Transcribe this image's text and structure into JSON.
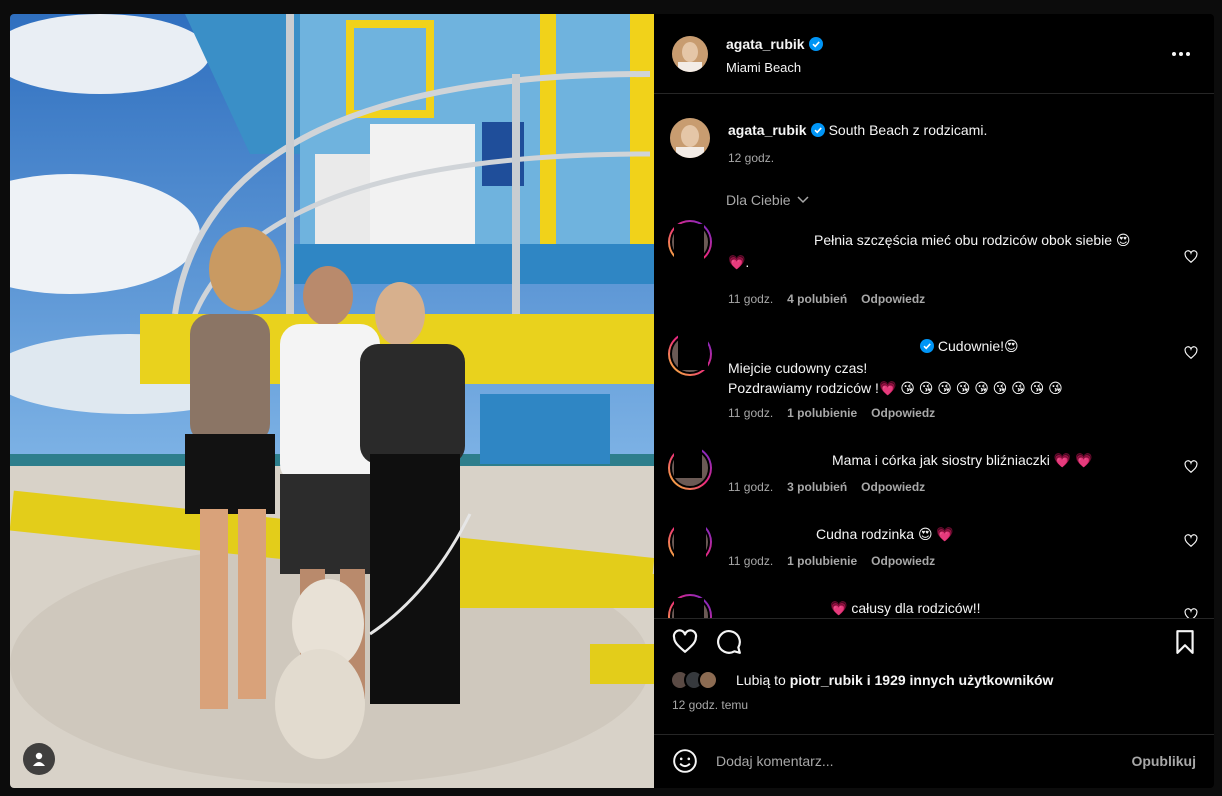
{
  "post": {
    "username": "agata_rubik",
    "location": "Miami Beach",
    "caption": "South Beach z rodzicami.",
    "caption_time": "12 godz.",
    "filter_label": "Dla Ciebie",
    "likes_prefix": "Lubią to ",
    "likes_user": "piotr_rubik",
    "likes_suffix": " i 1929 innych użytkowników",
    "posted": "12 godz. temu",
    "add_placeholder": "Dodaj komentarz...",
    "publish_label": "Opublikuj"
  },
  "comments": [
    {
      "text": "Pełnia szczęścia mieć obu rodziców obok siebie 😍",
      "text2": "💗.",
      "time": "11 godz.",
      "likes": "4 polubień",
      "reply": "Odpowiedz"
    },
    {
      "text": "Cudownie!😍",
      "text2": "Miejcie cudowny czas!",
      "text3": "Pozdrawiamy rodziców !💗 😘 😘 😘 😘 😘 😘 😘 😘 😘",
      "time": "11 godz.",
      "likes": "1 polubienie",
      "reply": "Odpowiedz"
    },
    {
      "text": "Mama i córka jak siostry bliźniaczki 💗 💗",
      "time": "11 godz.",
      "likes": "3 polubień",
      "reply": "Odpowiedz"
    },
    {
      "text": "Cudna rodzinka 😍 💗",
      "time": "11 godz.",
      "likes": "1 polubienie",
      "reply": "Odpowiedz"
    },
    {
      "text": "💗 całusy dla rodziców!!"
    }
  ],
  "icons": {
    "heart": "heart-icon",
    "comment": "comment-icon",
    "bookmark": "bookmark-icon",
    "emoji": "emoji-icon",
    "more": "more-icon",
    "tag": "user-tag-icon"
  },
  "colors": {
    "verified": "#0095f6",
    "muted": "#a8a8a8",
    "background": "#000000"
  }
}
